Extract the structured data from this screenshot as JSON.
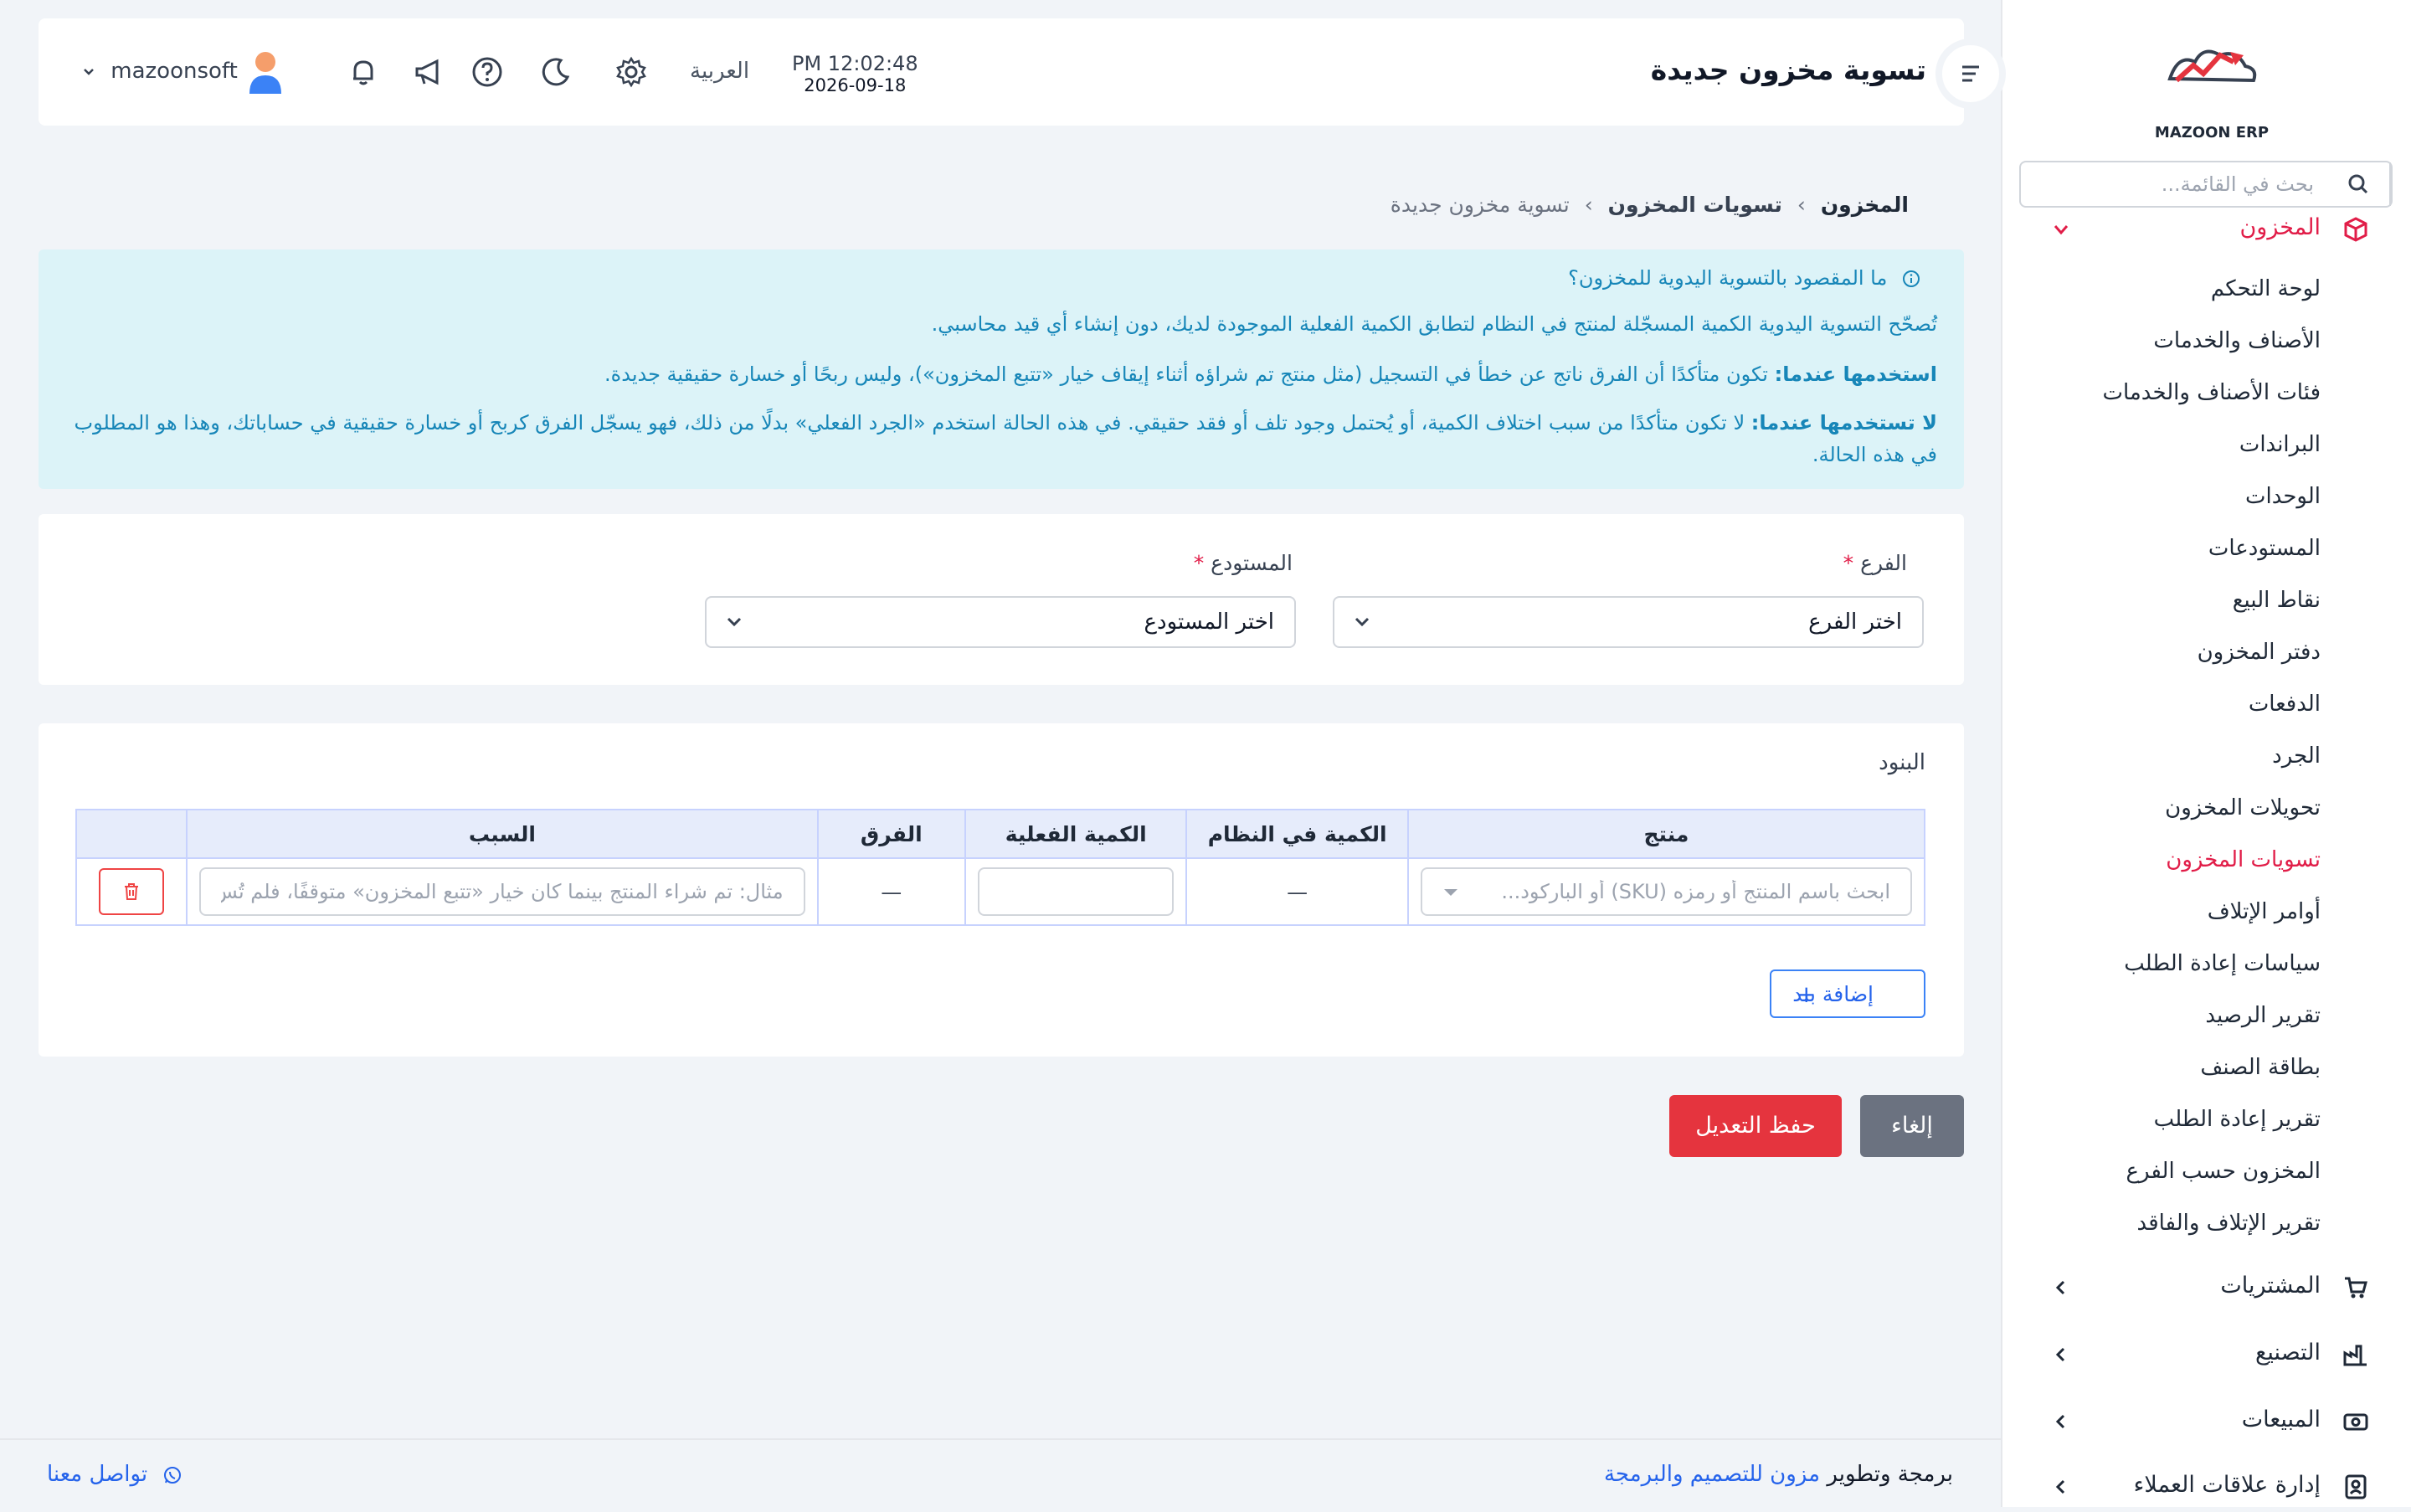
{
  "header": {
    "title": "تسوية مخزون جديدة",
    "time": "PM 12:02:48",
    "date": "2026-09-18",
    "language": "العربية",
    "username": "mazoonsoft"
  },
  "sidebar": {
    "logo_text": "MAZOON ERP",
    "search_placeholder": "بحث في القائمة...",
    "inventory_label": "المخزون",
    "items": [
      {
        "label": "لوحة التحكم"
      },
      {
        "label": "الأصناف والخدمات"
      },
      {
        "label": "فئات الأصناف والخدمات"
      },
      {
        "label": "البراندات"
      },
      {
        "label": "الوحدات"
      },
      {
        "label": "المستودعات"
      },
      {
        "label": "نقاط البيع"
      },
      {
        "label": "دفتر المخزون"
      },
      {
        "label": "الدفعات"
      },
      {
        "label": "الجرد"
      },
      {
        "label": "تحويلات المخزون"
      },
      {
        "label": "تسويات المخزون"
      },
      {
        "label": "أوامر الإتلاف"
      },
      {
        "label": "سياسات إعادة الطلب"
      },
      {
        "label": "تقرير الرصيد"
      },
      {
        "label": "بطاقة الصنف"
      },
      {
        "label": "تقرير إعادة الطلب"
      },
      {
        "label": "المخزون حسب الفرع"
      },
      {
        "label": "تقرير الإتلاف والفاقد"
      }
    ],
    "sections": [
      {
        "label": "المشتريات"
      },
      {
        "label": "التصنيع"
      },
      {
        "label": "المبيعات"
      },
      {
        "label": "إدارة علاقات العملاء"
      }
    ]
  },
  "breadcrumb": {
    "b1": "المخزون",
    "b2": "تسويات المخزون",
    "b3": "تسوية مخزون جديدة",
    "sep": "›"
  },
  "info": {
    "question": "ما المقصود بالتسوية اليدوية للمخزون؟",
    "p1": "تُصحّح التسوية اليدوية الكمية المسجّلة لمنتج في النظام لتطابق الكمية الفعلية الموجودة لديك، دون إنشاء أي قيد محاسبي.",
    "p2_bold": "استخدمها عندما:",
    "p2": " تكون متأكدًا أن الفرق ناتج عن خطأ في التسجيل (مثل منتج تم شراؤه أثناء إيقاف خيار «تتبع المخزون»)، وليس ربحًا أو خسارة حقيقية جديدة.",
    "p3_bold": "لا تستخدمها عندما:",
    "p3": " لا تكون متأكدًا من سبب اختلاف الكمية، أو يُحتمل وجود تلف أو فقد حقيقي. في هذه الحالة استخدم «الجرد الفعلي» بدلًا من ذلك، فهو يسجّل الفرق كربح أو خسارة حقيقية في حساباتك، وهذا هو المطلوب في هذه الحالة."
  },
  "form": {
    "branch_label": "الفرع",
    "branch_value": "اختر الفرع",
    "warehouse_label": "المستودع",
    "warehouse_value": "اختر المستودع",
    "required_mark": "*"
  },
  "items_section": {
    "title": "البنود",
    "columns": [
      "منتج",
      "الكمية في النظام",
      "الكمية الفعلية",
      "الفرق",
      "السبب"
    ],
    "row": {
      "product_placeholder": "ابحث باسم المنتج أو رمزه (SKU) أو الباركود...",
      "system_qty": "—",
      "actual_qty": "",
      "difference": "—",
      "reason_placeholder": "مثال: تم شراء المنتج بينما كان خيار «تتبع المخزون» متوقفًا، فلم تُس"
    },
    "add_label": "إضافة بند",
    "add_plus": "+"
  },
  "actions": {
    "cancel": "إلغاء",
    "save": "حفظ التعديل"
  },
  "footer": {
    "prefix": "برمجة وتطوير",
    "link": "مزون للتصميم والبرمجة",
    "contact": "تواصل معنا"
  },
  "colors": {
    "accent": "#e5343e",
    "info_bg": "#dcf3f8",
    "info_text": "#1786b8",
    "link": "#2563eb"
  }
}
